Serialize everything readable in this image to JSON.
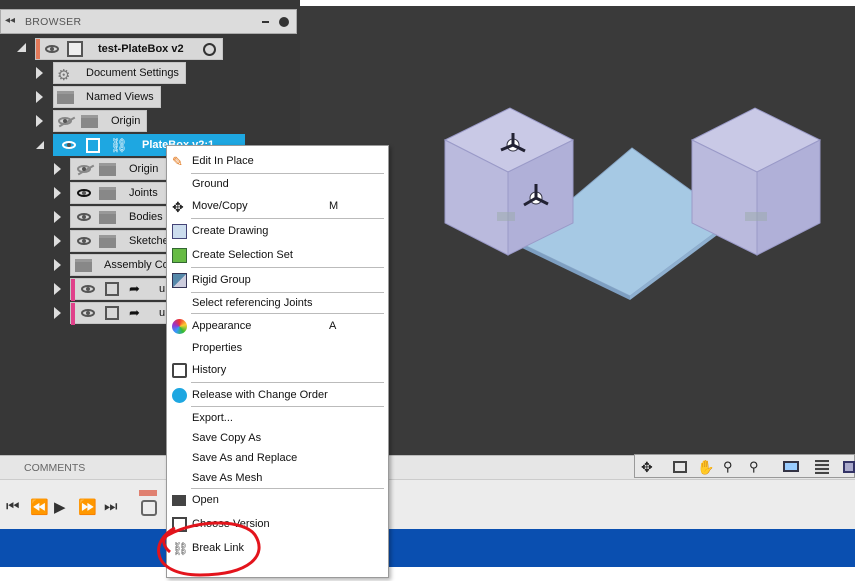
{
  "browser": {
    "title": "BROWSER",
    "collapse_glyph": "◂◂",
    "root_label": "test-PlateBox v2",
    "items": {
      "document_settings": "Document Settings",
      "named_views": "Named Views",
      "origin": "Origin",
      "platebox": "PlateBox v2:1",
      "sub_origin": "Origin",
      "joints": "Joints",
      "bodies": "Bodies",
      "sketches": "Sketche",
      "assembly_context": "Assembly Co",
      "link1": "u",
      "link2": "u"
    }
  },
  "comments": {
    "label": "COMMENTS"
  },
  "context_menu": {
    "edit_in_place": "Edit In Place",
    "ground": "Ground",
    "move_copy": "Move/Copy",
    "move_copy_key": "M",
    "create_drawing": "Create Drawing",
    "create_selection_set": "Create Selection Set",
    "rigid_group": "Rigid Group",
    "select_referencing_joints": "Select referencing Joints",
    "appearance": "Appearance",
    "appearance_key": "A",
    "properties": "Properties",
    "history": "History",
    "release_with_change_order": "Release with Change Order",
    "export": "Export...",
    "save_copy_as": "Save Copy As",
    "save_as_and_replace": "Save As and Replace",
    "save_as_mesh": "Save As Mesh",
    "open": "Open",
    "choose_version": "Choose Version",
    "break_link": "Break Link"
  },
  "colors": {
    "accent": "#1ea7e1",
    "annotation": "#e3141c",
    "timeline_marker": "#e0408a",
    "status_bar": "#0a4fb0"
  }
}
